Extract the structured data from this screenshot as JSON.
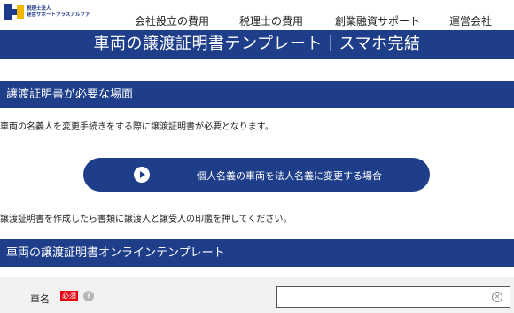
{
  "header": {
    "logo_lines": [
      "税理士法人",
      "経営サポートプラスアルファ"
    ],
    "nav": [
      "会社設立の費用",
      "税理士の費用",
      "創業融資サポート",
      "運営会社"
    ]
  },
  "page_title": "車両の譲渡証明書テンプレート｜スマホ完結",
  "section1": {
    "heading": "譲渡証明書が必要な場面",
    "text": "車両の名義人を変更手続きをする際に譲渡証明書が必要となります。"
  },
  "action_button": {
    "label": "個人名義の車両を法人名義に変更する場合",
    "icon": "play-circle-icon"
  },
  "note": "譲渡証明書を作成したら書類に譲渡人と譲受人の印鑑を押してください。",
  "section2": {
    "heading": "車両の譲渡証明書オンラインテンプレート"
  },
  "form": {
    "field_label": "車名",
    "required_badge": "必須",
    "help_icon": "?",
    "clear_icon": "×",
    "input_value": "",
    "input_placeholder": ""
  },
  "colors": {
    "brand_navy": "#1e3e8a",
    "required_red": "#e60012",
    "logo_yellow": "#f5b800"
  }
}
